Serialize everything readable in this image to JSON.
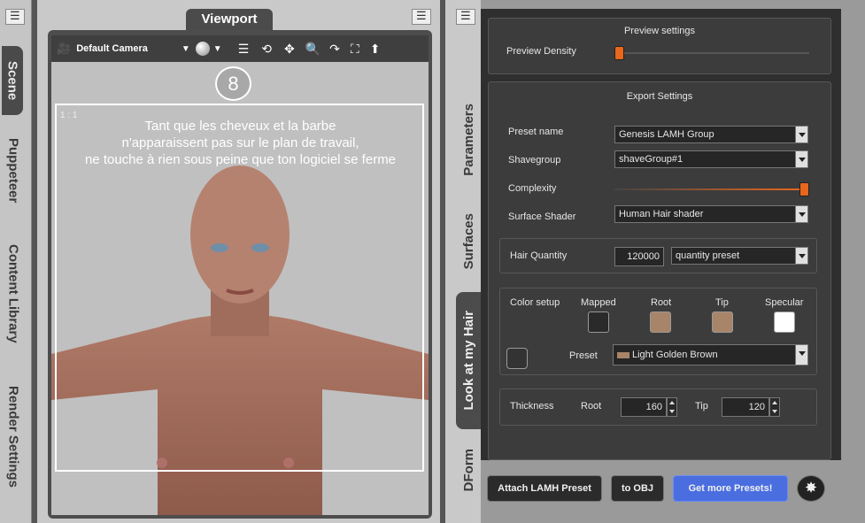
{
  "left_tabs": [
    "Scene",
    "Puppeteer",
    "Content Library",
    "Render Settings"
  ],
  "viewport": {
    "tab": "Viewport",
    "camera": "Default Camera",
    "badge": "8",
    "ratio": "1 : 1",
    "overlay_lines": [
      "Tant que les cheveux et la barbe",
      "n'apparaissent pas sur le plan de travail,",
      "ne touche à rien sous peine que ton logiciel se ferme"
    ]
  },
  "right_tabs": [
    "Parameters",
    "Surfaces",
    "Look at my Hair",
    "DForm"
  ],
  "preview": {
    "title": "Preview settings",
    "density_label": "Preview Density",
    "density_value": 0.0
  },
  "export": {
    "title": "Export Settings",
    "preset_label": "Preset name",
    "preset_value": "Genesis LAMH Group",
    "shavegroup_label": "Shavegroup",
    "shavegroup_value": "shaveGroup#1",
    "complexity_label": "Complexity",
    "complexity_value": 1.0,
    "shader_label": "Surface Shader",
    "shader_value": "Human Hair shader"
  },
  "quantity": {
    "label": "Hair Quantity",
    "value": "120000",
    "preset": "quantity preset"
  },
  "color": {
    "label": "Color setup",
    "mapped": "Mapped",
    "root": "Root",
    "tip": "Tip",
    "specular": "Specular",
    "preset_label": "Preset",
    "preset_value": "Light Golden Brown",
    "colors": {
      "mapped": "#2a2a2a",
      "root": "#a88468",
      "tip": "#a88468",
      "specular": "#ffffff",
      "preset_chip": "#a88468"
    }
  },
  "thickness": {
    "label": "Thickness",
    "root_label": "Root",
    "root_value": "160",
    "tip_label": "Tip",
    "tip_value": "120"
  },
  "buttons": {
    "attach": "Attach LAMH Preset",
    "to_obj": "to OBJ",
    "get_more": "Get more Presets!"
  },
  "accent_color": "#e8671c",
  "link_button_color": "#4a6ee0"
}
